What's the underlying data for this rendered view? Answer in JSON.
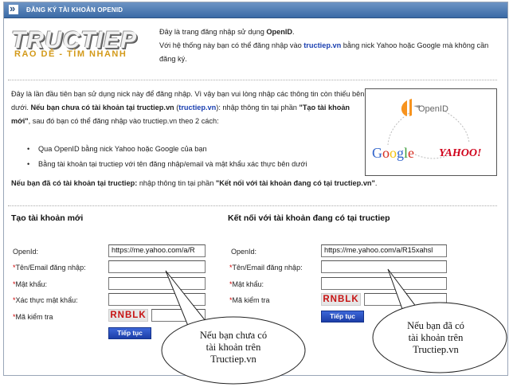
{
  "header": {
    "title": "ĐĂNG KÝ TÀI KHOẢN OPENID"
  },
  "logo": {
    "brand": "TRUCTIEP",
    "tagline": "RAO DỄ - TÌM NHANH"
  },
  "intro": {
    "line1_pre": "Đây là trang đăng nhập sử dụng ",
    "line1_bold": "OpenID",
    "line1_post": ".",
    "line2_pre": "Với hệ thống này bạn có thể đăng nhập vào ",
    "line2_link": "tructiep.vn",
    "line2_post": " bằng nick Yahoo hoặc Google mà không cần đăng ký."
  },
  "para": {
    "t1": "Đây là lần đầu tiên bạn sử dụng nick này để đăng nhập. Vì vậy bạn vui lòng nhập các thông tin còn thiếu bên dưới. ",
    "b1": "Nếu bạn chưa có tài khoản tại tructiep.vn",
    "t2": " (",
    "l1": "tructiep.vn",
    "t3": "): nhập thông tin tại phần ",
    "b2": "\"Tạo tài khoản mới\"",
    "t4": ", sau đó bạn có thể đăng nhập vào tructiep.vn theo 2 cách:"
  },
  "bullets": [
    "Qua OpenID bằng nick Yahoo hoặc Google của bạn",
    "Bằng tài khoản tại tructiep với tên đăng nhập/email và mật khẩu xác thực bên dưới"
  ],
  "note": {
    "b1": "Nếu bạn đã có tài khoản tại tructiep:",
    "t1": " nhập thông tin tại phần ",
    "b2": "\"Kết nối với tài khoản đang có tại tructiep.vn\"",
    "t2": "."
  },
  "providers": {
    "openid": "OpenID",
    "google": "Google",
    "yahoo": "YAHOO!"
  },
  "create": {
    "title": "Tạo tài khoản mới",
    "openid_label": "OpenId:",
    "openid_value": "https://me.yahoo.com/a/R",
    "username_label": "Tên/Email đăng nhập:",
    "password_label": "Mật khẩu:",
    "confirm_label": "Xác thực mật khẩu:",
    "captcha_label": "Mã kiểm tra",
    "captcha_code": "RNBLK",
    "submit": "Tiếp tục"
  },
  "connect": {
    "title": "Kết nối với tài khoản đang có tại tructiep",
    "openid_label": "OpenId:",
    "openid_value": "https://me.yahoo.com/a/R15xahsl",
    "username_label": "Tên/Email đăng nhập:",
    "password_label": "Mật khẩu:",
    "captcha_label": "Mã kiểm tra",
    "captcha_code": "RNBLK",
    "submit": "Tiếp tục"
  },
  "callouts": {
    "left": [
      "Nếu bạn chưa có",
      "tài khoản trên",
      "Tructiep.vn"
    ],
    "right": [
      "Nếu bạn đã có",
      "tài khoản trên",
      "Tructiep.vn"
    ]
  },
  "required_marker": "*",
  "colors": {
    "header": "#3a6aa6",
    "link": "#1a3fb0",
    "required": "#cc0000",
    "captcha": "#c71313",
    "button": "#1c3ea8"
  }
}
